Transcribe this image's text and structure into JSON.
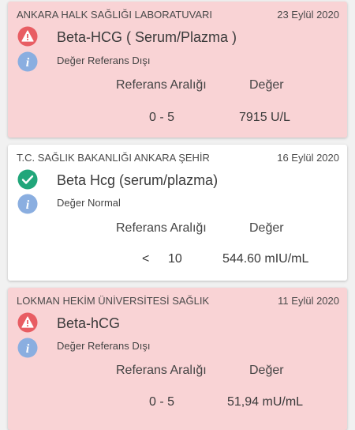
{
  "colors": {
    "abnormal_bg": "#f9d3d5",
    "normal_bg": "#ffffff",
    "warning_icon": "#e85d63",
    "check_icon": "#21a67a",
    "info_icon": "#8aaee0"
  },
  "results": [
    {
      "lab": "ANKARA HALK SAĞLIĞI LABORATUVARI",
      "date": "23 Eylül 2020",
      "status_icon": "warning-icon",
      "info_icon": "info-icon",
      "test": "Beta-HCG ( Serum/Plazma )",
      "status": "Değer Referans Dışı",
      "reference_header": "Referans Aralığı",
      "value_header": "Değer",
      "reference_range": "0 - 5",
      "value": "7915 U/L"
    },
    {
      "lab": "T.C. SAĞLIK BAKANLIĞI ANKARA ŞEHİR",
      "date": "16 Eylül 2020",
      "status_icon": "check-icon",
      "info_icon": "info-icon",
      "test": "Beta Hcg (serum/plazma)",
      "status": "Değer Normal",
      "reference_header": "Referans Aralığı",
      "value_header": "Değer",
      "reference_operator": "<",
      "reference_range": "10",
      "value": "544.60 mIU/mL"
    },
    {
      "lab": "LOKMAN HEKİM ÜNİVERSİTESİ SAĞLIK",
      "date": "11 Eylül 2020",
      "status_icon": "warning-icon",
      "info_icon": "info-icon",
      "test": "Beta-hCG",
      "status": "Değer Referans Dışı",
      "reference_header": "Referans Aralığı",
      "value_header": "Değer",
      "reference_range": "0 - 5",
      "value": "51,94 mU/mL"
    }
  ]
}
